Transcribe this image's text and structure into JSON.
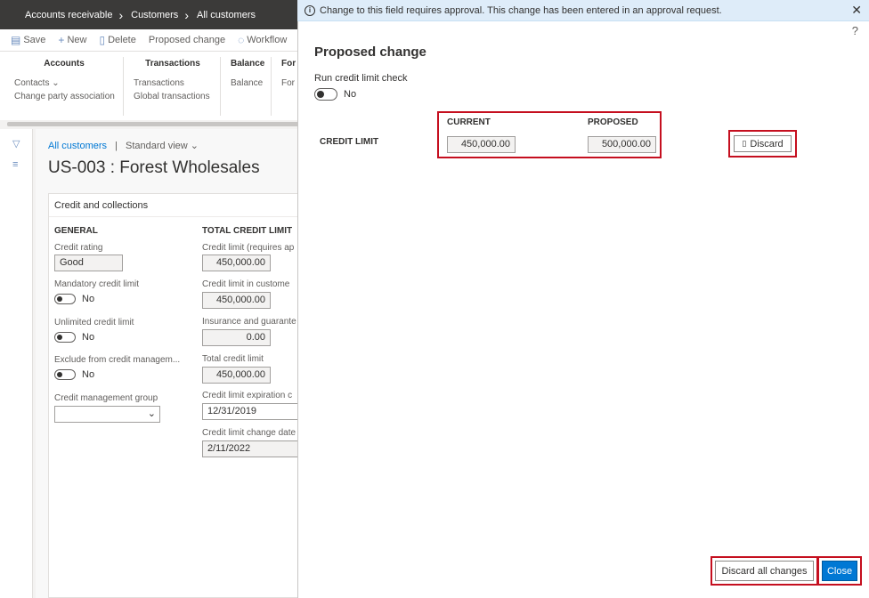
{
  "nav": {
    "items": [
      "Accounts receivable",
      "Customers",
      "All customers"
    ]
  },
  "actions": {
    "save": "Save",
    "new": "New",
    "delete": "Delete",
    "proposed_change": "Proposed change",
    "workflow": "Workflow"
  },
  "ribbon": {
    "accounts": {
      "header": "Accounts",
      "items": [
        "Contacts",
        "Change party association"
      ]
    },
    "transactions": {
      "header": "Transactions",
      "items": [
        "Transactions",
        "Global transactions"
      ]
    },
    "balance": {
      "header": "Balance",
      "items": [
        "Balance"
      ]
    },
    "forecast": {
      "header": "For",
      "items": [
        "For"
      ]
    }
  },
  "record": {
    "breadcrumb_link": "All customers",
    "separator": "|",
    "view": "Standard view",
    "title": "US-003 : Forest Wholesales"
  },
  "card": {
    "title": "Credit and collections",
    "general": {
      "header": "GENERAL",
      "credit_rating_label": "Credit rating",
      "credit_rating_value": "Good",
      "mandatory_label": "Mandatory credit limit",
      "mandatory_value": "No",
      "unlimited_label": "Unlimited credit limit",
      "unlimited_value": "No",
      "exclude_label": "Exclude from credit managem...",
      "exclude_value": "No",
      "group_label": "Credit management group",
      "group_value": ""
    },
    "total": {
      "header": "TOTAL CREDIT LIMIT",
      "limit_label": "Credit limit (requires ap",
      "limit_value": "450,000.00",
      "limit_cust_label": "Credit limit in custome",
      "limit_cust_value": "450,000.00",
      "insurance_label": "Insurance and guarante",
      "insurance_value": "0.00",
      "total_label": "Total credit limit",
      "total_value": "450,000.00",
      "expiry_label": "Credit limit expiration c",
      "expiry_value": "12/31/2019",
      "change_date_label": "Credit limit change date",
      "change_date_value": "2/11/2022"
    }
  },
  "info": {
    "icon": "i",
    "message": "Change to this field requires approval. This change has been entered in an approval request."
  },
  "dialog": {
    "help": "?",
    "title": "Proposed change",
    "run_check_label": "Run credit limit check",
    "run_check_value": "No",
    "current_header": "CURRENT",
    "proposed_header": "PROPOSED",
    "row_label": "CREDIT LIMIT",
    "current_value": "450,000.00",
    "proposed_value": "500,000.00",
    "discard_label": "Discard",
    "discard_all_label": "Discard all changes",
    "close_label": "Close"
  },
  "colors": {
    "highlight": "#c50f1f",
    "primary": "#0078d4",
    "nav": "#3b3a39",
    "info_bg": "#deecf9"
  }
}
